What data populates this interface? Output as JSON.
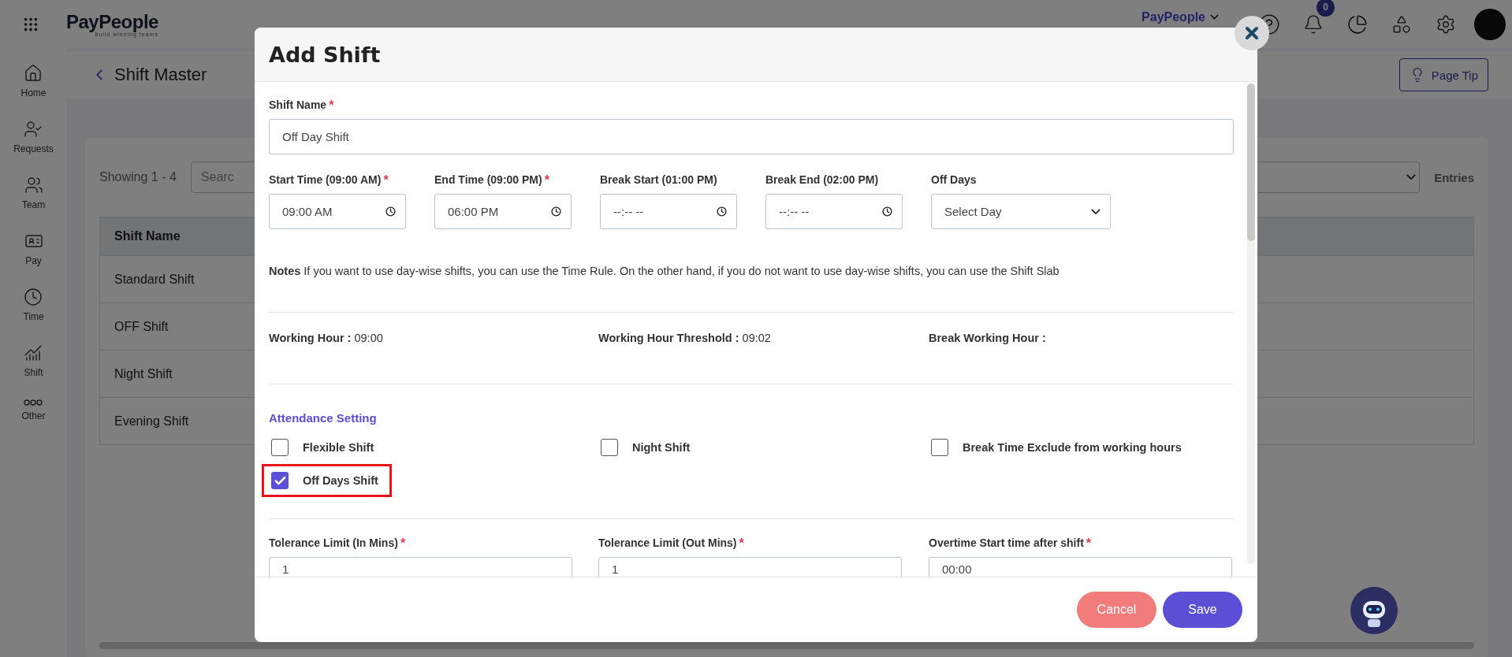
{
  "header": {
    "logo": "PayPeople",
    "tagline": "build winning teams",
    "company": "PayPeople",
    "notification_count": "0"
  },
  "sidebar": {
    "items": [
      {
        "label": "Home"
      },
      {
        "label": "Requests"
      },
      {
        "label": "Team"
      },
      {
        "label": "Pay"
      },
      {
        "label": "Time"
      },
      {
        "label": "Shift"
      },
      {
        "label": "Other"
      }
    ]
  },
  "page": {
    "title": "Shift Master",
    "page_tip": "Page Tip",
    "showing": "Showing 1 - 4",
    "search_placeholder": "Searc",
    "entries_label": "Entries",
    "table": {
      "columns": [
        "Shift Name"
      ],
      "rows": [
        [
          "Standard Shift"
        ],
        [
          "OFF Shift"
        ],
        [
          "Night Shift"
        ],
        [
          "Evening Shift"
        ]
      ]
    }
  },
  "modal": {
    "title": "Add Shift",
    "shift_name": {
      "label": "Shift Name",
      "required_mark": "*",
      "value": "Off Day Shift"
    },
    "time_fields": [
      {
        "kind": "time",
        "label": "Start Time (09:00 AM)",
        "required_mark": "*",
        "value": "09:00 AM"
      },
      {
        "kind": "time",
        "label": "End Time (09:00 PM)",
        "required_mark": "*",
        "value": "06:00 PM"
      },
      {
        "kind": "time",
        "label": "Break Start (01:00 PM)",
        "value": "--:-- --"
      },
      {
        "kind": "time",
        "label": "Break End (02:00 PM)",
        "value": "--:-- --"
      },
      {
        "kind": "select",
        "label": "Off Days",
        "value": "Select Day"
      }
    ],
    "notes": "**Notes** If you want to use day-wise shifts, you can use the Time Rule. On the other hand, if you do not want to use day-wise shifts, you can use the Shift Slab",
    "hours": [
      {
        "label": "Working Hour :",
        "value": "09:00"
      },
      {
        "label": "Working Hour Threshold :",
        "value": "09:02"
      },
      {
        "label": "Break Working Hour :"
      }
    ],
    "attendance": {
      "title": "Attendance Setting",
      "options": [
        {
          "label": "Flexible Shift",
          "checked": false,
          "highlighted": false
        },
        {
          "label": "Night Shift",
          "checked": false,
          "highlighted": false
        },
        {
          "label": "Break Time Exclude from working hours",
          "checked": false,
          "highlighted": false
        },
        {
          "label": "Off Days Shift",
          "checked": true,
          "highlighted": true
        }
      ]
    },
    "limits": [
      {
        "label": "Tolerance Limit (In Mins)",
        "required_mark": "*",
        "value": "1"
      },
      {
        "label": "Tolerance Limit (Out Mins)",
        "required_mark": "*",
        "value": "1"
      },
      {
        "label": "Overtime Start time after shift",
        "required_mark": "*",
        "value": "00:00"
      }
    ],
    "buttons": [
      {
        "label": "Cancel",
        "kind": "secondary"
      },
      {
        "label": "Save",
        "kind": "primary"
      }
    ]
  }
}
